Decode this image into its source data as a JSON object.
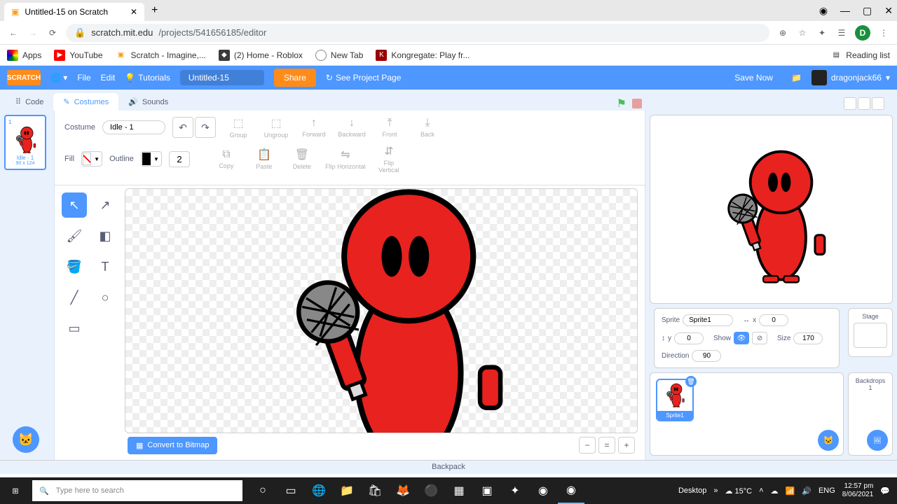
{
  "browser": {
    "tab_title": "Untitled-15 on Scratch",
    "url_host": "scratch.mit.edu",
    "url_path": "/projects/541656185/editor",
    "reading_list": "Reading list"
  },
  "bookmarks": {
    "apps": "Apps",
    "youtube": "YouTube",
    "scratch": "Scratch - Imagine,...",
    "roblox": "(2) Home - Roblox",
    "newtab": "New Tab",
    "kongregate": "Kongregate: Play fr..."
  },
  "scratch_header": {
    "file": "File",
    "edit": "Edit",
    "tutorials": "Tutorials",
    "project_name": "Untitled-15",
    "share": "Share",
    "see_project": "See Project Page",
    "save_now": "Save Now",
    "username": "dragonjack66"
  },
  "tabs": {
    "code": "Code",
    "costumes": "Costumes",
    "sounds": "Sounds"
  },
  "costume": {
    "label": "Costume",
    "name": "Idle - 1",
    "thumb_name": "Idle - 1",
    "thumb_size": "90 x 124"
  },
  "toolbar": {
    "group": "Group",
    "ungroup": "Ungroup",
    "forward": "Forward",
    "backward": "Backward",
    "front": "Front",
    "back": "Back",
    "fill": "Fill",
    "outline": "Outline",
    "outline_width": "2",
    "copy": "Copy",
    "paste": "Paste",
    "delete": "Delete",
    "fliph": "Flip Horizontal",
    "flipv": "Flip Vertical",
    "convert": "Convert to Bitmap"
  },
  "sprite_info": {
    "sprite_label": "Sprite",
    "sprite_name": "Sprite1",
    "x_label": "x",
    "x": "0",
    "y_label": "y",
    "y": "0",
    "show_label": "Show",
    "size_label": "Size",
    "size": "170",
    "direction_label": "Direction",
    "direction": "90"
  },
  "stage_panel": {
    "stage": "Stage",
    "backdrops": "Backdrops",
    "backdrop_count": "1"
  },
  "backpack": "Backpack",
  "taskbar": {
    "search_placeholder": "Type here to search",
    "desktop": "Desktop",
    "weather": "15°C",
    "lang": "ENG",
    "time": "12:57 pm",
    "date": "8/06/2021"
  }
}
